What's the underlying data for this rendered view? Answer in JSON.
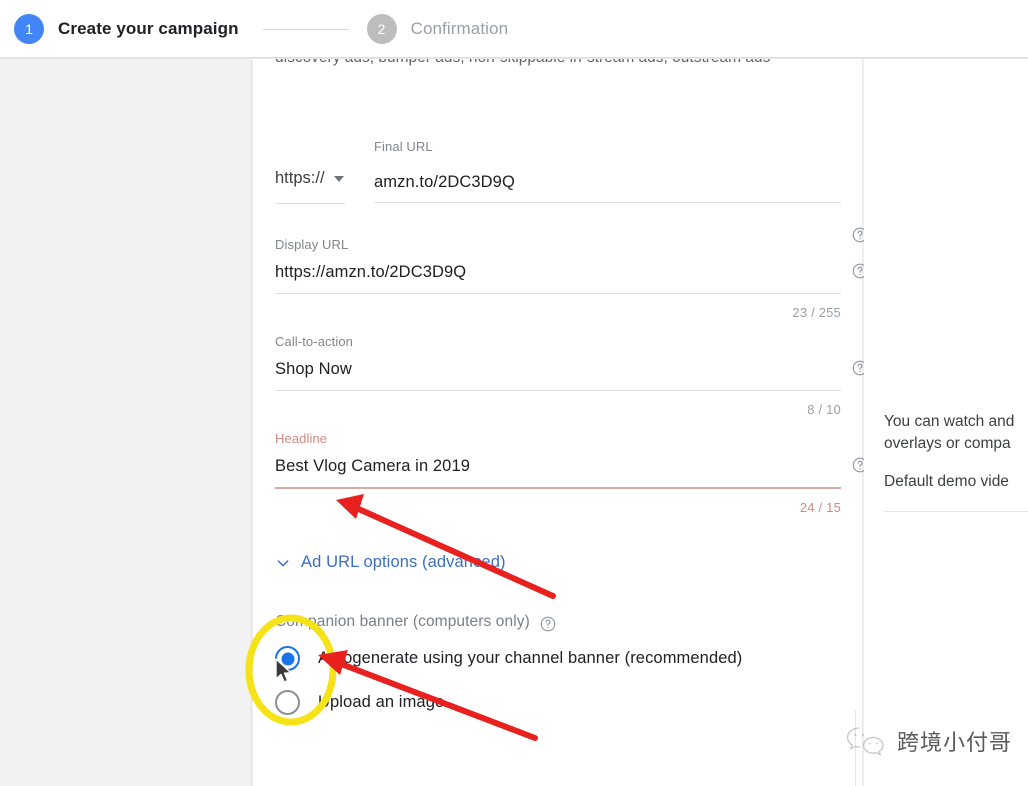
{
  "stepper": {
    "steps": [
      {
        "num": "1",
        "label": "Create your campaign",
        "state": "active"
      },
      {
        "num": "2",
        "label": "Confirmation",
        "state": "inactive"
      }
    ]
  },
  "card": {
    "clipped_top_text": "discovery ads, bumper ads, non-skippable in-stream ads, outstream ads",
    "final_url": {
      "label": "Final URL",
      "protocol": "https://",
      "value": "amzn.to/2DC3D9Q",
      "help": "help-icon"
    },
    "display_url": {
      "label": "Display URL",
      "value": "https://amzn.to/2DC3D9Q",
      "counter": "23 / 255"
    },
    "call_to_action": {
      "label": "Call-to-action",
      "value": "Shop Now",
      "counter": "8 / 10"
    },
    "headline": {
      "label": "Headline",
      "value": "Best Vlog Camera in 2019",
      "counter": "24 / 15",
      "error": true
    },
    "ad_url_options": {
      "label": "Ad URL options (advanced)"
    },
    "companion_banner": {
      "label": "Companion banner (computers only)",
      "options": [
        {
          "label": "Autogenerate using your channel banner (recommended)",
          "selected": true
        },
        {
          "label": "Upload an image",
          "selected": false
        }
      ]
    }
  },
  "right_panel": {
    "paragraph_line1": "You can watch and",
    "paragraph_line2": "overlays or compa",
    "paragraph2": "Default demo vide"
  },
  "watermark": {
    "text": "跨境小付哥"
  },
  "colors": {
    "accent_blue": "#4285f4",
    "link_blue": "#3c6ec0",
    "radio_blue": "#1a73e8",
    "error_red": "#d08a82",
    "annotation_red": "#e8201e",
    "annotation_yellow": "#f5e317",
    "inactive_gray": "#bdbdbd",
    "label_gray": "#80868b"
  }
}
